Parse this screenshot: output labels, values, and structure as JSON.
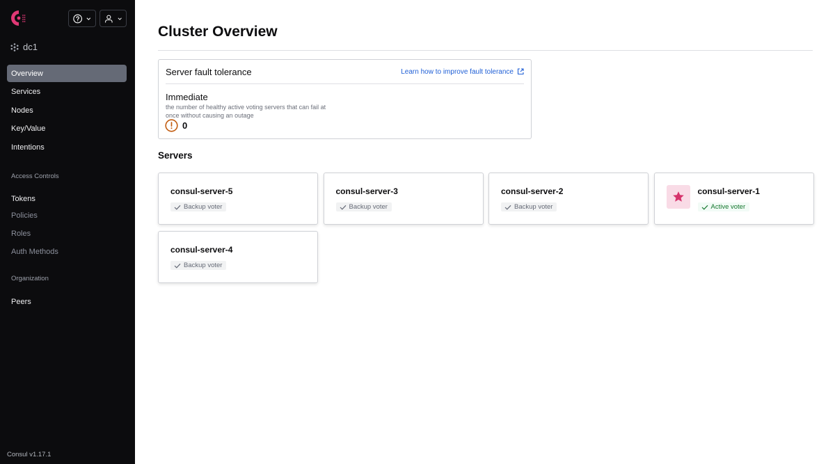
{
  "header": {
    "help_menu": {
      "icon": "help-circle-icon",
      "chevron": "chevron-down-icon"
    },
    "user_menu": {
      "icon": "user-icon",
      "chevron": "chevron-down-icon"
    },
    "logo": "consul-logo",
    "datacenter": {
      "icon": "datacenter-icon",
      "label": "dc1"
    }
  },
  "sidebar": {
    "items": [
      {
        "label": "Overview",
        "active": true
      },
      {
        "label": "Services"
      },
      {
        "label": "Nodes"
      },
      {
        "label": "Key/Value"
      },
      {
        "label": "Intentions"
      }
    ],
    "access_controls": {
      "heading": "Access Controls",
      "items": [
        {
          "label": "Tokens"
        },
        {
          "label": "Policies",
          "muted": true
        },
        {
          "label": "Roles",
          "muted": true
        },
        {
          "label": "Auth Methods",
          "muted": true
        }
      ]
    },
    "organization": {
      "heading": "Organization",
      "items": [
        {
          "label": "Peers"
        }
      ]
    },
    "version": "Consul v1.17.1"
  },
  "main": {
    "title": "Cluster Overview",
    "fault_tolerance": {
      "title": "Server fault tolerance",
      "link": "Learn how to improve fault tolerance",
      "link_icon": "external-link-icon",
      "immediate_label": "Immediate",
      "description": "the number of healthy active voting servers that can fail at once without causing an outage",
      "value": "0",
      "value_icon": "alert-circle-icon",
      "warning_color": "#c25d11"
    },
    "servers_title": "Servers",
    "servers": [
      {
        "name": "consul-server-5",
        "status": "Backup voter",
        "leader": false
      },
      {
        "name": "consul-server-3",
        "status": "Backup voter",
        "leader": false
      },
      {
        "name": "consul-server-2",
        "status": "Backup voter",
        "leader": false
      },
      {
        "name": "consul-server-1",
        "status": "Active voter",
        "leader": true
      },
      {
        "name": "consul-server-4",
        "status": "Backup voter",
        "leader": false
      }
    ]
  },
  "colors": {
    "brand": "#e03875",
    "link": "#1f5fd6",
    "active_voter": "#15772e"
  }
}
